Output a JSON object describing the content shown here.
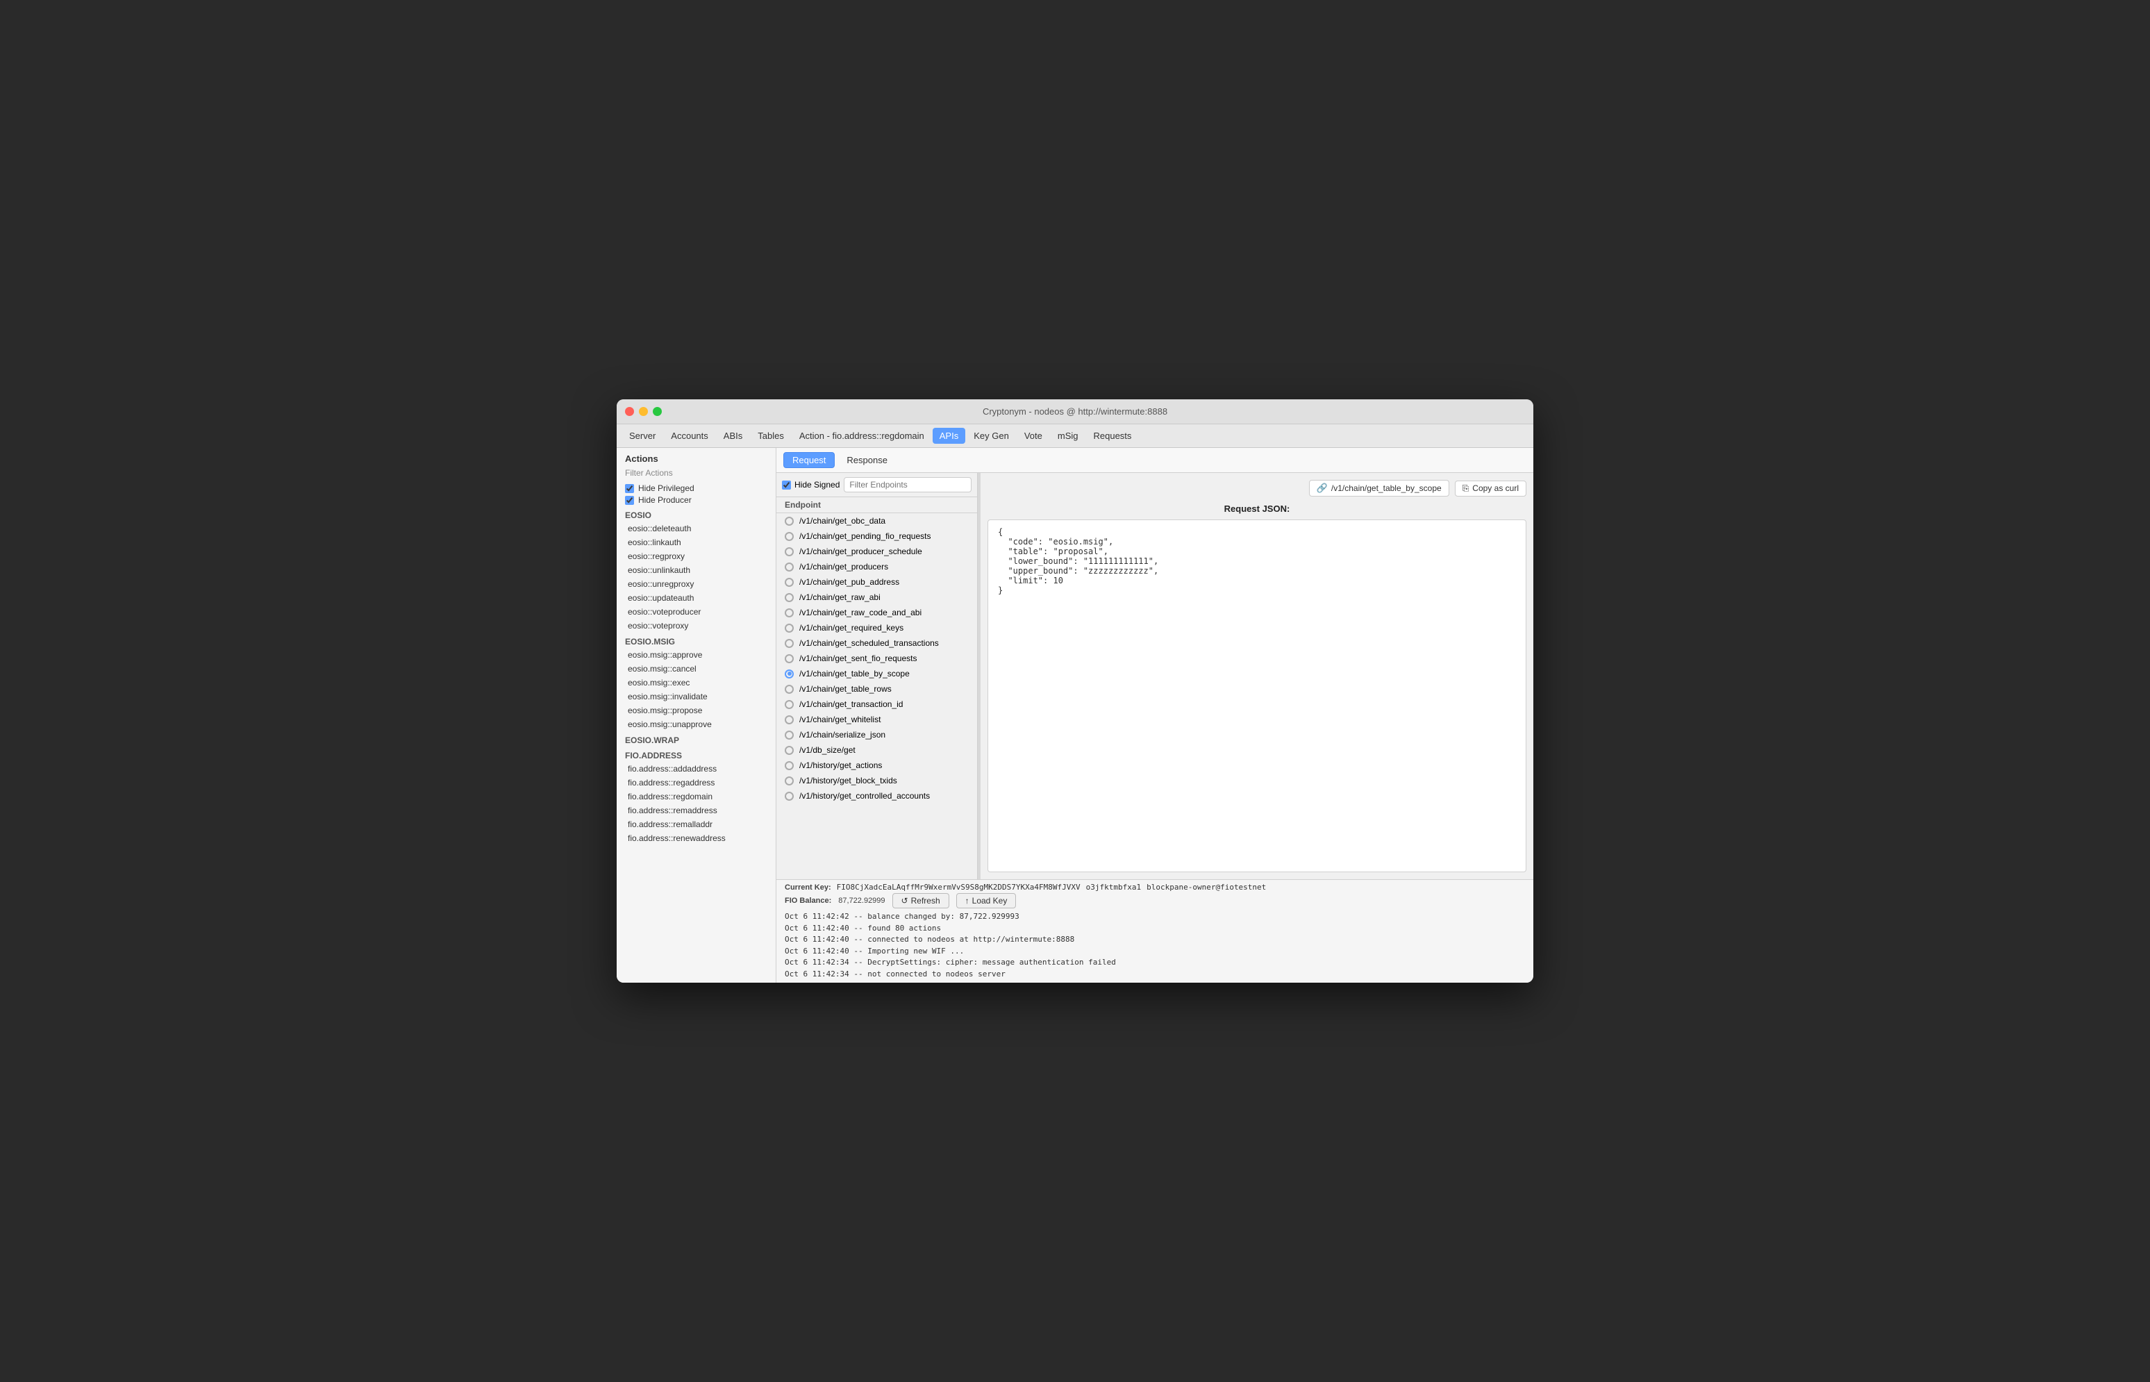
{
  "window": {
    "title": "Cryptonym - nodeos @ http://wintermute:8888",
    "traffic_lights": [
      "red",
      "yellow",
      "green"
    ]
  },
  "nav": {
    "tabs": [
      {
        "label": "Server",
        "active": false
      },
      {
        "label": "Accounts",
        "active": false
      },
      {
        "label": "ABIs",
        "active": false
      },
      {
        "label": "Tables",
        "active": false
      },
      {
        "label": "Action - fio.address::regdomain",
        "active": false
      },
      {
        "label": "APIs",
        "active": true
      },
      {
        "label": "Key Gen",
        "active": false
      },
      {
        "label": "Vote",
        "active": false
      },
      {
        "label": "mSig",
        "active": false
      },
      {
        "label": "Requests",
        "active": false
      }
    ]
  },
  "sidebar": {
    "header": "Actions",
    "filter_label": "Filter Actions",
    "checkboxes": [
      {
        "label": "Hide Privileged",
        "checked": true
      },
      {
        "label": "Hide Producer",
        "checked": true
      }
    ],
    "sections": [
      {
        "label": "EOSIO",
        "items": [
          "eosio::deleteauth",
          "eosio::linkauth",
          "eosio::regproxy",
          "eosio::unlinkauth",
          "eosio::unregproxy",
          "eosio::updateauth",
          "eosio::voteproducer",
          "eosio::voteproxy"
        ]
      },
      {
        "label": "EOSIO.MSIG",
        "items": [
          "eosio.msig::approve",
          "eosio.msig::cancel",
          "eosio.msig::exec",
          "eosio.msig::invalidate",
          "eosio.msig::propose",
          "eosio.msig::unapprove"
        ]
      },
      {
        "label": "EOSIO.WRAP",
        "items": []
      },
      {
        "label": "FIO.ADDRESS",
        "items": [
          "fio.address::addaddress",
          "fio.address::regaddress",
          "fio.address::regdomain",
          "fio.address::remaddress",
          "fio.address::remalladdr",
          "fio.address::renewaddress"
        ]
      }
    ]
  },
  "panel": {
    "tabs": [
      {
        "label": "Request",
        "active": true
      },
      {
        "label": "Response",
        "active": false
      }
    ],
    "hide_signed_checked": true,
    "hide_signed_label": "Hide Signed",
    "filter_endpoints_placeholder": "Filter Endpoints",
    "endpoints_column_header": "Endpoint",
    "endpoints": [
      {
        "path": "/v1/chain/get_obc_data",
        "selected": false,
        "visible_partial": true
      },
      {
        "path": "/v1/chain/get_pending_fio_requests",
        "selected": false
      },
      {
        "path": "/v1/chain/get_producer_schedule",
        "selected": false
      },
      {
        "path": "/v1/chain/get_producers",
        "selected": false
      },
      {
        "path": "/v1/chain/get_pub_address",
        "selected": false
      },
      {
        "path": "/v1/chain/get_raw_abi",
        "selected": false
      },
      {
        "path": "/v1/chain/get_raw_code_and_abi",
        "selected": false
      },
      {
        "path": "/v1/chain/get_required_keys",
        "selected": false
      },
      {
        "path": "/v1/chain/get_scheduled_transactions",
        "selected": false
      },
      {
        "path": "/v1/chain/get_sent_fio_requests",
        "selected": false
      },
      {
        "path": "/v1/chain/get_table_by_scope",
        "selected": true
      },
      {
        "path": "/v1/chain/get_table_rows",
        "selected": false
      },
      {
        "path": "/v1/chain/get_transaction_id",
        "selected": false
      },
      {
        "path": "/v1/chain/get_whitelist",
        "selected": false
      },
      {
        "path": "/v1/chain/serialize_json",
        "selected": false
      },
      {
        "path": "/v1/db_size/get",
        "selected": false
      },
      {
        "path": "/v1/history/get_actions",
        "selected": false
      },
      {
        "path": "/v1/history/get_block_txids",
        "selected": false
      },
      {
        "path": "/v1/history/get_controlled_accounts",
        "selected": false,
        "partial": true
      }
    ],
    "selected_endpoint": "/v1/chain/get_table_by_scope",
    "copy_curl_label": "Copy as curl",
    "request_json_label": "Request JSON:",
    "request_json": "{\n  \"code\": \"eosio.msig\",\n  \"table\": \"proposal\",\n  \"lower_bound\": \"111111111111\",\n  \"upper_bound\": \"zzzzzzzzzzzz\",\n  \"limit\": 10\n}"
  },
  "bottom": {
    "current_key_label": "Current Key:",
    "current_key_value": "FIO8CjXadcEaLAqffMr9WxermVvS9S8gMK2DDS7YKXa4FM8WfJVXV",
    "key_alias1": "o3jfktmbfxa1",
    "key_alias2": "blockpane-owner@fiotestnet",
    "balance_label": "FIO Balance:",
    "balance_value": "87,722.92999",
    "refresh_label": "Refresh",
    "load_key_label": "Load Key",
    "logs": [
      "Oct  6 11:42:42 -- balance changed by: 87,722.929993",
      "Oct  6 11:42:40 -- found 80 actions",
      "Oct  6 11:42:40 -- connected to nodeos at http://wintermute:8888",
      "Oct  6 11:42:40 -- Importing new WIF ...",
      "Oct  6 11:42:34 -- DecryptSettings: cipher: message authentication failed",
      "Oct  6 11:42:34 -- not connected to nodeos server"
    ]
  },
  "icons": {
    "copy": "⎘",
    "refresh": "↺",
    "load": "↑",
    "endpoint": "🔗"
  }
}
